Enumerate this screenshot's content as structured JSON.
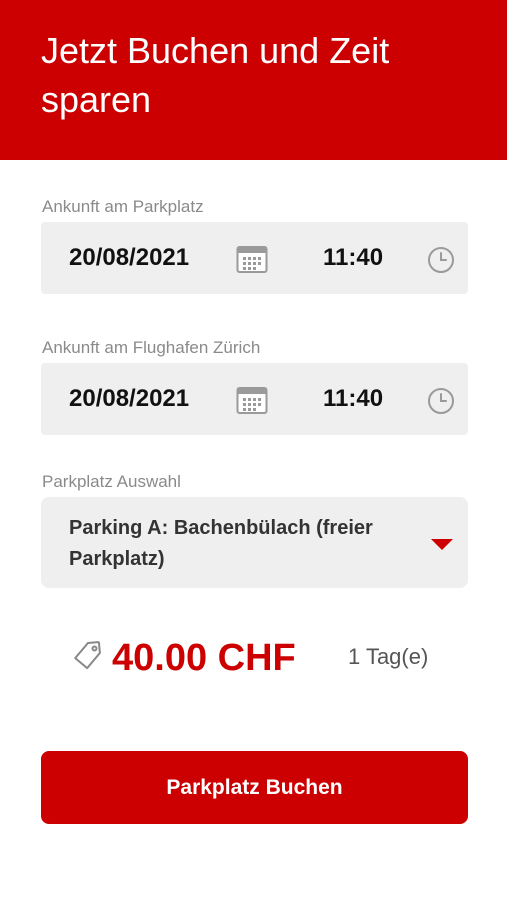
{
  "header": {
    "title": "Jetzt Buchen und Zeit sparen"
  },
  "arrival_parking": {
    "label": "Ankunft am Parkplatz",
    "date": "20/08/2021",
    "time": "11:40"
  },
  "arrival_airport": {
    "label": "Ankunft am Flughafen Zürich",
    "date": "20/08/2021",
    "time": "11:40"
  },
  "parking_select": {
    "label": "Parkplatz Auswahl",
    "selected": "Parking A: Bachenbülach (freier Parkplatz)"
  },
  "price": {
    "amount": "40.00 CHF",
    "duration": "1 Tag(e)"
  },
  "book_button": {
    "label": "Parkplatz Buchen"
  },
  "colors": {
    "brand": "#cc0000",
    "field_bg": "#efefef",
    "label": "#8a8a8a"
  },
  "icons": [
    "calendar-icon",
    "clock-icon",
    "chevron-down-icon",
    "price-tag-icon"
  ]
}
